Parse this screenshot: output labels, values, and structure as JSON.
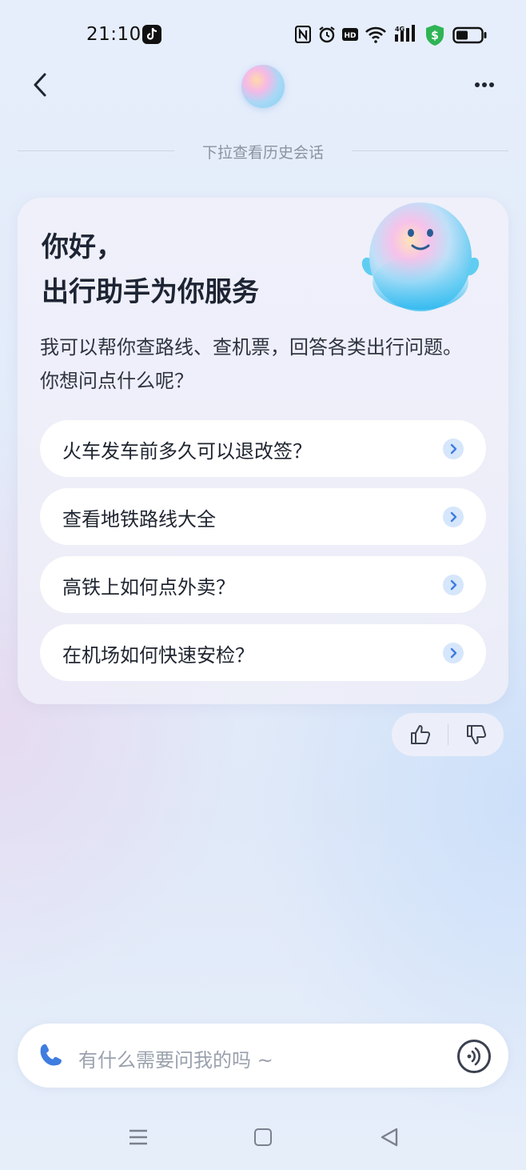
{
  "status_bar": {
    "time": "21:10",
    "network": "4G"
  },
  "header": {
    "history_hint": "下拉查看历史会话"
  },
  "greeting": {
    "title_line1": "你好，",
    "title_line2": "出行助手为你服务",
    "subtitle": "我可以帮你查路线、查机票，回答各类出行问题。你想问点什么呢？"
  },
  "suggestions": [
    {
      "label": "火车发车前多久可以退改签？"
    },
    {
      "label": "查看地铁路线大全"
    },
    {
      "label": "高铁上如何点外卖？"
    },
    {
      "label": "在机场如何快速安检？"
    }
  ],
  "input": {
    "placeholder": "有什么需要问我的吗 ~"
  },
  "colors": {
    "accent": "#3f7de0",
    "chevron_bg": "#d6e6fb",
    "card_bg": "#efeff9"
  }
}
